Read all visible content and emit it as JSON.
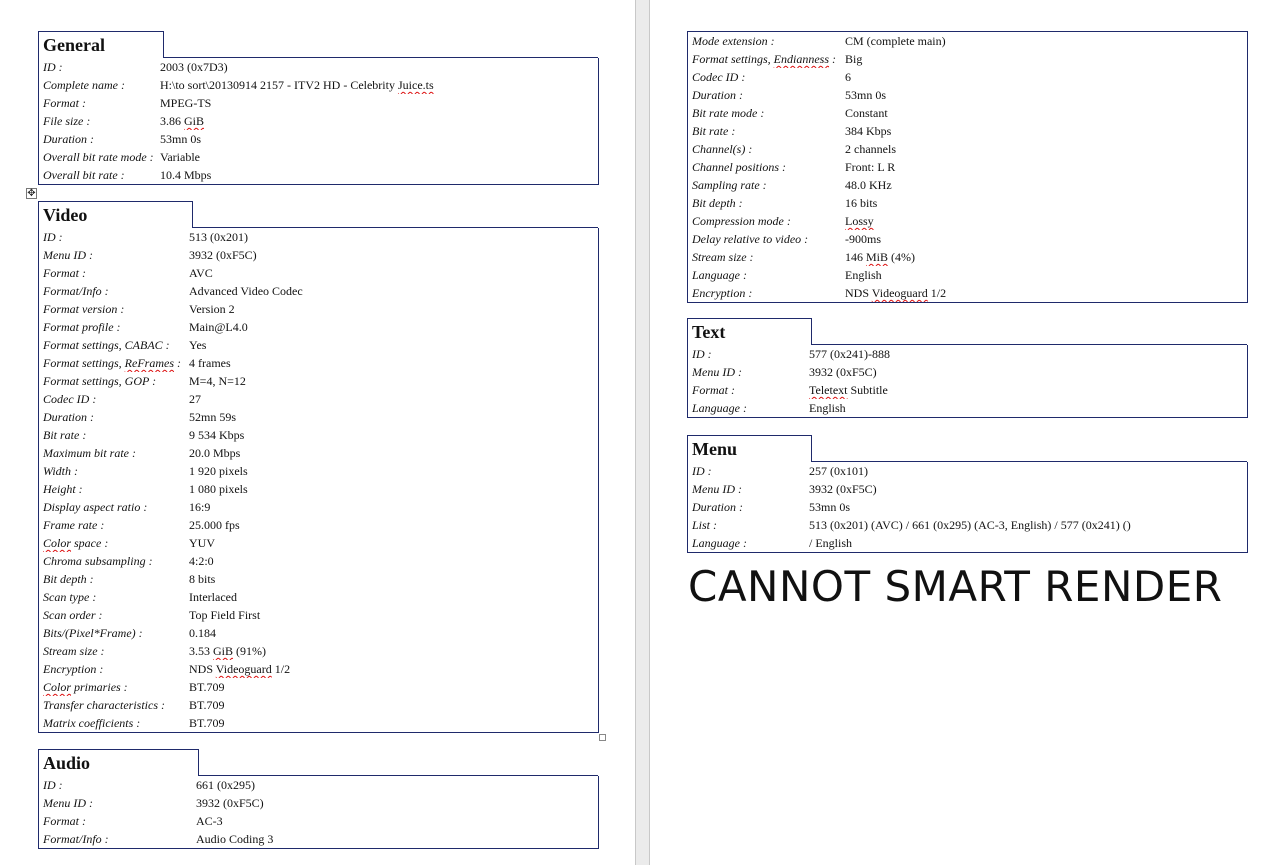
{
  "general": {
    "title": "General",
    "rows": [
      {
        "k": "ID :",
        "v": "2003 (0x7D3)"
      },
      {
        "k": "Complete name :",
        "v": "H:\\to sort\\20130914 2157 - ITV2 HD - Celebrity Juice.ts"
      },
      {
        "k": "Format :",
        "v": "MPEG-TS"
      },
      {
        "k": "File size :",
        "v": "3.86 GiB"
      },
      {
        "k": "Duration :",
        "v": "53mn 0s"
      },
      {
        "k": "Overall bit rate mode :",
        "v": "Variable"
      },
      {
        "k": "Overall bit rate :",
        "v": "10.4 Mbps"
      }
    ]
  },
  "video": {
    "title": "Video",
    "rows": [
      {
        "k": "ID :",
        "v": "513 (0x201)"
      },
      {
        "k": "Menu ID :",
        "v": "3932 (0xF5C)"
      },
      {
        "k": "Format :",
        "v": "AVC"
      },
      {
        "k": "Format/Info :",
        "v": "Advanced Video Codec"
      },
      {
        "k": "Format version :",
        "v": "Version 2"
      },
      {
        "k": "Format profile :",
        "v": "Main@L4.0"
      },
      {
        "k": "Format settings, CABAC :",
        "v": "Yes"
      },
      {
        "k": "Format settings, ReFrames :",
        "v": "4 frames"
      },
      {
        "k": "Format settings, GOP :",
        "v": "M=4, N=12"
      },
      {
        "k": "Codec ID :",
        "v": "27"
      },
      {
        "k": "Duration :",
        "v": "52mn 59s"
      },
      {
        "k": "Bit rate :",
        "v": "9 534 Kbps"
      },
      {
        "k": "Maximum bit rate :",
        "v": "20.0 Mbps"
      },
      {
        "k": "Width :",
        "v": "1 920 pixels"
      },
      {
        "k": "Height :",
        "v": "1 080 pixels"
      },
      {
        "k": "Display aspect ratio :",
        "v": "16:9"
      },
      {
        "k": "Frame rate :",
        "v": "25.000 fps"
      },
      {
        "k": "Color space :",
        "v": "YUV"
      },
      {
        "k": "Chroma subsampling :",
        "v": "4:2:0"
      },
      {
        "k": "Bit depth :",
        "v": "8 bits"
      },
      {
        "k": "Scan type :",
        "v": "Interlaced"
      },
      {
        "k": "Scan order :",
        "v": "Top Field First"
      },
      {
        "k": "Bits/(Pixel*Frame) :",
        "v": "0.184"
      },
      {
        "k": "Stream size :",
        "v": "3.53 GiB (91%)"
      },
      {
        "k": "Encryption :",
        "v": "NDS Videoguard 1/2"
      },
      {
        "k": "Color primaries :",
        "v": "BT.709"
      },
      {
        "k": "Transfer characteristics :",
        "v": "BT.709"
      },
      {
        "k": "Matrix coefficients :",
        "v": "BT.709"
      }
    ]
  },
  "audio": {
    "title": "Audio",
    "rows": [
      {
        "k": "ID :",
        "v": "661 (0x295)"
      },
      {
        "k": "Menu ID :",
        "v": "3932 (0xF5C)"
      },
      {
        "k": "Format :",
        "v": "AC-3"
      },
      {
        "k": "Format/Info :",
        "v": "Audio Coding 3"
      }
    ]
  },
  "audio_cont": {
    "rows": [
      {
        "k": "Mode extension :",
        "v": "CM (complete main)"
      },
      {
        "k": "Format settings, Endianness :",
        "v": "Big"
      },
      {
        "k": "Codec ID :",
        "v": "6"
      },
      {
        "k": "Duration :",
        "v": "53mn 0s"
      },
      {
        "k": "Bit rate mode :",
        "v": "Constant"
      },
      {
        "k": "Bit rate :",
        "v": "384 Kbps"
      },
      {
        "k": "Channel(s) :",
        "v": "2 channels"
      },
      {
        "k": "Channel positions :",
        "v": "Front: L R"
      },
      {
        "k": "Sampling rate :",
        "v": "48.0 KHz"
      },
      {
        "k": "Bit depth :",
        "v": "16 bits"
      },
      {
        "k": "Compression mode :",
        "v": "Lossy"
      },
      {
        "k": "Delay relative to video :",
        "v": "-900ms"
      },
      {
        "k": "Stream size :",
        "v": "146 MiB (4%)"
      },
      {
        "k": "Language :",
        "v": "English"
      },
      {
        "k": "Encryption :",
        "v": "NDS Videoguard 1/2"
      }
    ]
  },
  "text": {
    "title": "Text",
    "rows": [
      {
        "k": "ID :",
        "v": "577 (0x241)-888"
      },
      {
        "k": "Menu ID :",
        "v": "3932 (0xF5C)"
      },
      {
        "k": "Format :",
        "v": "Teletext Subtitle"
      },
      {
        "k": "Language :",
        "v": "English"
      }
    ]
  },
  "menu": {
    "title": "Menu",
    "rows": [
      {
        "k": "ID :",
        "v": "257 (0x101)"
      },
      {
        "k": "Menu ID :",
        "v": "3932 (0xF5C)"
      },
      {
        "k": "Duration :",
        "v": "53mn 0s"
      },
      {
        "k": "List :",
        "v": "513 (0x201) (AVC) / 661 (0x295) (AC-3, English) / 577 (0x241) ()"
      },
      {
        "k": "Language :",
        "v": "/ English"
      }
    ]
  },
  "banner": "CANNOT SMART RENDER",
  "colors": {
    "border": "#1f2a6b",
    "spellcheck": "#d11111"
  }
}
